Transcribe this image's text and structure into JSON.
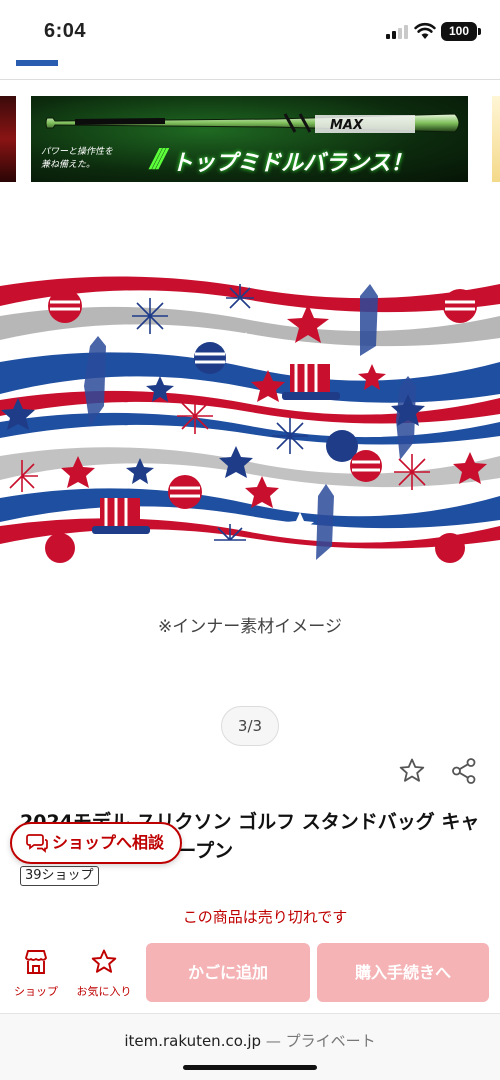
{
  "status_bar": {
    "time": "6:04",
    "battery": "100"
  },
  "banner": {
    "subtitle_line1": "パワーと操作性を",
    "subtitle_line2": "兼ね備えた。",
    "headline": "トップミドルバランス！",
    "bat_label": "MAX"
  },
  "product": {
    "image_caption": "※インナー素材イメージ",
    "pager": "3/3",
    "title": "2024モデル スリクソン ゴルフ スタンドバッグ キャディバッグ 全米オープン",
    "shop_count": "39ショップ",
    "sold_out_notice": "この商品は売り切れです"
  },
  "consult_button": {
    "label": "ショップへ相談"
  },
  "bottom_bar": {
    "shop_label": "ショップ",
    "favorite_label": "お気に入り",
    "add_to_cart_label": "かごに追加",
    "checkout_label": "購入手続きへ"
  },
  "browser": {
    "domain": "item.rakuten.co.jp",
    "mode": "— プライベート"
  },
  "colors": {
    "accent": "#bf0000",
    "disabled_button": "#f5b3b6",
    "patriot_red": "#c8102e",
    "patriot_blue": "#1f3c88"
  }
}
